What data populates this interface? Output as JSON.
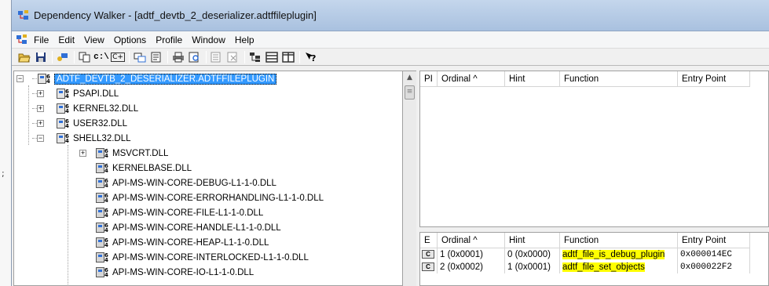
{
  "window": {
    "title": "Dependency Walker - [adtf_devtb_2_deserializer.adtffileplugin]"
  },
  "menu": [
    "File",
    "Edit",
    "View",
    "Options",
    "Profile",
    "Window",
    "Help"
  ],
  "toolbar": {
    "buttons": [
      "open-icon",
      "save-icon",
      "configure-icon",
      "copy-icon",
      "full-paths-icon",
      "undecorate-icon",
      "print-icon",
      "properties-icon",
      "find-icon",
      "view-full-icon",
      "expand-icon",
      "collapse-icon",
      "module-list-icon",
      "help-icon"
    ],
    "paths_label": "c:\\",
    "undecorate_label": "C+"
  },
  "tree": {
    "root": "ADTF_DEVTB_2_DESERIALIZER.ADTFFILEPLUGIN",
    "level1": [
      "PSAPI.DLL",
      "KERNEL32.DLL",
      "USER32.DLL",
      "SHELL32.DLL"
    ],
    "shell32_children": [
      "MSVCRT.DLL",
      "KERNELBASE.DLL",
      "API-MS-WIN-CORE-DEBUG-L1-1-0.DLL",
      "API-MS-WIN-CORE-ERRORHANDLING-L1-1-0.DLL",
      "API-MS-WIN-CORE-FILE-L1-1-0.DLL",
      "API-MS-WIN-CORE-HANDLE-L1-1-0.DLL",
      "API-MS-WIN-CORE-HEAP-L1-1-0.DLL",
      "API-MS-WIN-CORE-INTERLOCKED-L1-1-0.DLL",
      "API-MS-WIN-CORE-IO-L1-1-0.DLL"
    ]
  },
  "imports_table": {
    "columns": [
      "PI",
      "Ordinal ^",
      "Hint",
      "Function",
      "Entry Point"
    ]
  },
  "exports_table": {
    "columns": [
      "E",
      "Ordinal ^",
      "Hint",
      "Function",
      "Entry Point"
    ],
    "rows": [
      {
        "icon": "C",
        "ordinal": "1 (0x0001)",
        "hint": "0 (0x0000)",
        "function": "adtf_file_is_debug_plugin",
        "entry": "0x000014EC"
      },
      {
        "icon": "C",
        "ordinal": "2 (0x0002)",
        "hint": "1 (0x0001)",
        "function": "adtf_file_set_objects",
        "entry": "0x000022F2"
      }
    ]
  },
  "colors": {
    "selection": "#3399ff",
    "highlight": "#ffff00",
    "titlebar": "#b8cde8"
  }
}
